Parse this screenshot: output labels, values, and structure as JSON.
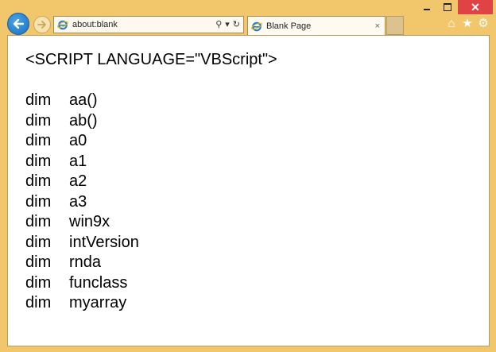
{
  "window": {
    "caption": {
      "minimize": "—",
      "maximize": "□",
      "close": "✕"
    }
  },
  "nav": {
    "address": {
      "url": "about:blank",
      "controls": [
        "⚲",
        "▾",
        "↻"
      ]
    },
    "tab": {
      "title": "Blank Page",
      "close": "×"
    },
    "toolbar_icons": [
      "home-icon",
      "star-icon",
      "gear-icon"
    ]
  },
  "page": {
    "script_tag": "<SCRIPT LANGUAGE=\"VBScript\">",
    "keyword": "dim",
    "variables": [
      "aa()",
      "ab()",
      "a0",
      "a1",
      "a2",
      "a3",
      "win9x",
      "intVersion",
      "rnda",
      "funclass",
      "myarray"
    ]
  },
  "colors": {
    "frame": "#f2c66b",
    "back_button": "#1a6fc1",
    "close_button": "#e04343"
  }
}
